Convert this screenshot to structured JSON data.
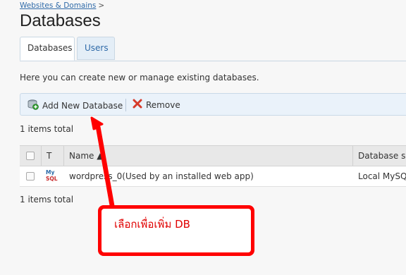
{
  "breadcrumb": {
    "link": "Websites & Domains",
    "separator": ">"
  },
  "page_title": "Databases",
  "tabs": [
    {
      "label": "Databases",
      "active": true
    },
    {
      "label": "Users",
      "active": false
    }
  ],
  "description": "Here you can create new or manage existing databases.",
  "toolbar": {
    "add_label": "Add New Database",
    "add_icon": "database-add-icon",
    "remove_label": "Remove",
    "remove_icon": "red-x-icon"
  },
  "items_total_top": "1 items total",
  "items_total_bottom": "1 items total",
  "table": {
    "columns": [
      "T",
      "Name ▲",
      "Database se"
    ],
    "rows": [
      {
        "type_icon": "mysql-icon",
        "type_text_top": "My",
        "type_text_bottom": "SQL",
        "name": "wordpress_0(Used by an installed web app)",
        "server": "Local MySQL"
      }
    ]
  },
  "callout": {
    "text": "เลือกเพื่อเพิ่ม  DB"
  },
  "colors": {
    "link": "#2f6aa8",
    "annotation": "#ff0000",
    "toolbar_bg": "#eaf2fa"
  }
}
